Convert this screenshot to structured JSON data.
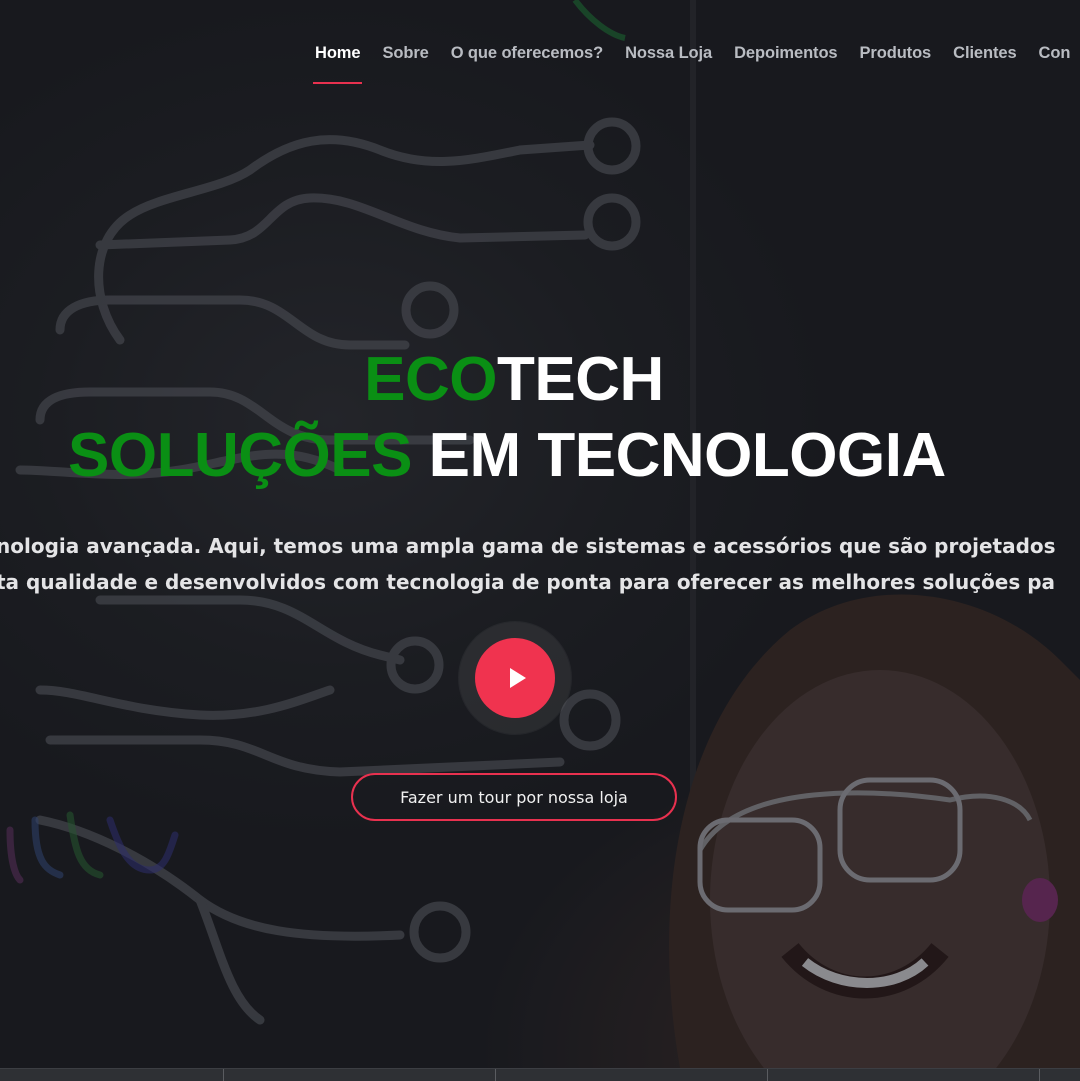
{
  "nav": {
    "items": [
      {
        "label": "Home",
        "active": true
      },
      {
        "label": "Sobre"
      },
      {
        "label": "O que oferecemos?"
      },
      {
        "label": "Nossa Loja"
      },
      {
        "label": "Depoimentos"
      },
      {
        "label": "Produtos"
      },
      {
        "label": "Clientes"
      },
      {
        "label": "Con"
      }
    ]
  },
  "hero": {
    "title_line1_green": "ECO",
    "title_line1_white": "TECH",
    "title_line2_green": "SOLUÇÕES",
    "title_line2_white": "EM TECNOLOGIA",
    "description_line1": "nologia avançada. Aqui, temos uma ampla gama de sistemas e acessórios que são projetados",
    "description_line2": "ta qualidade e desenvolvidos com tecnologia de ponta para oferecer as melhores soluções pa",
    "play_icon": "play-icon",
    "tour_button": "Fazer um tour por nossa loja"
  },
  "colors": {
    "accent": "#f0334f",
    "brand_green": "#0a8f14",
    "text_white": "#ffffff",
    "nav_text": "#b9bcc2"
  }
}
